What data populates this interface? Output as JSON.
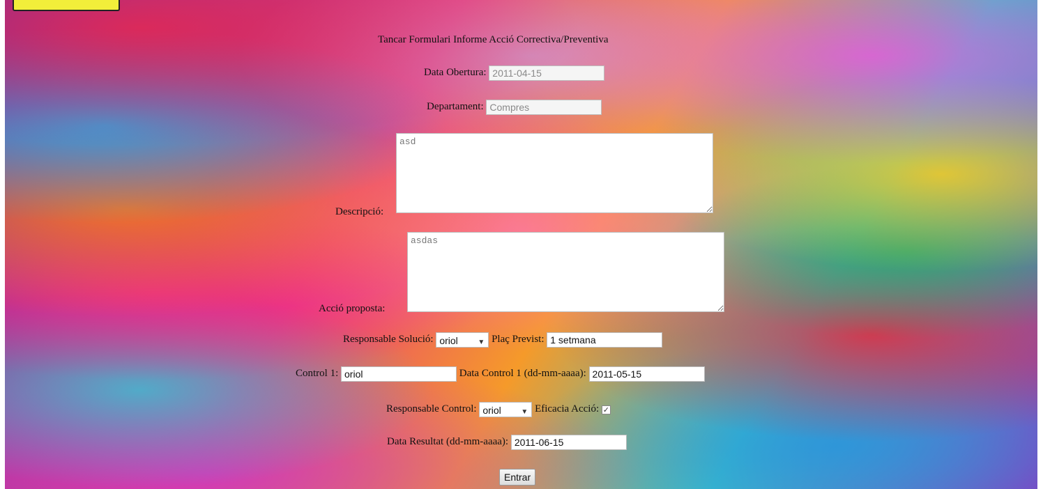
{
  "form": {
    "title": "Tancar Formulari Informe Acció Correctiva/Preventiva",
    "data_obertura": {
      "label": "Data Obertura:",
      "value": "2011-04-15"
    },
    "departament": {
      "label": "Departament:",
      "value": "Compres"
    },
    "descripcio": {
      "label": "Descripció:",
      "value": "asd"
    },
    "accio_proposta": {
      "label": "Acció proposta:",
      "value": "asdas"
    },
    "responsable_solucio": {
      "label": "Responsable Solució:",
      "value": "oriol"
    },
    "plac_previst": {
      "label": "Plaç Previst:",
      "value": "1 setmana"
    },
    "control1": {
      "label": "Control 1:",
      "value": "oriol"
    },
    "data_control1": {
      "label": "Data Control 1 (dd-mm-aaaa):",
      "value": "2011-05-15"
    },
    "responsable_control": {
      "label": "Responsable Control:",
      "value": "oriol"
    },
    "eficacia_accio": {
      "label": "Eficacia Acció:",
      "checked": true,
      "check_glyph": "✓"
    },
    "data_resultat": {
      "label": "Data Resultat (dd-mm-aaaa):",
      "value": "2011-06-15"
    },
    "submit_label": "Entrar"
  },
  "icons": {
    "dropdown": "chevron-down-icon",
    "resize": "resize-grip-icon"
  },
  "colors": {
    "badge": "#f2ee3a"
  }
}
